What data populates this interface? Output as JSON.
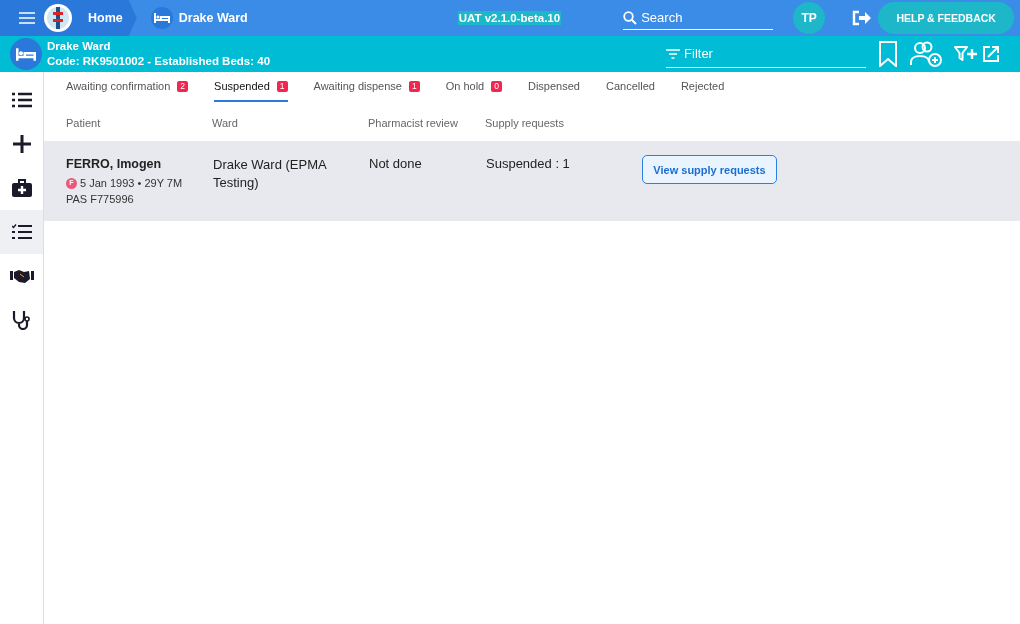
{
  "top_bar": {
    "breadcrumbs": [
      {
        "label": "Home",
        "kind": "home"
      },
      {
        "label": "Drake Ward",
        "kind": "ward"
      }
    ],
    "environment": "UAT v2.1.0-beta.10",
    "search": {
      "placeholder": "Search"
    },
    "user_initials": "TP",
    "help_button": "HELP & FEEDBACK"
  },
  "ward_bar": {
    "name": "Drake Ward",
    "details": "Code: RK9501002 - Established Beds: 40",
    "filter": {
      "placeholder": "Filter"
    }
  },
  "sidebar": {
    "items": [
      {
        "kind": "list",
        "selected": false
      },
      {
        "kind": "plus",
        "selected": false
      },
      {
        "kind": "medical-bag",
        "selected": false
      },
      {
        "kind": "checklist",
        "selected": true
      },
      {
        "kind": "handshake",
        "selected": false
      },
      {
        "kind": "stethoscope",
        "selected": false
      }
    ]
  },
  "tabs": [
    {
      "label": "Awaiting confirmation",
      "count": "2",
      "selected": false
    },
    {
      "label": "Suspended",
      "count": "1",
      "selected": true
    },
    {
      "label": "Awaiting dispense",
      "count": "1",
      "selected": false
    },
    {
      "label": "On hold",
      "count": "0",
      "selected": false
    },
    {
      "label": "Dispensed",
      "selected": false
    },
    {
      "label": "Cancelled",
      "selected": false
    },
    {
      "label": "Rejected",
      "selected": false
    }
  ],
  "table": {
    "columns": [
      "Patient",
      "Ward",
      "Pharmacist review",
      "Supply requests"
    ],
    "rows": [
      {
        "name": "FERRO, Imogen",
        "sex": "F",
        "dob": "5 Jan 1993 • 29Y 7M",
        "pas": "PAS F775996",
        "ward": "Drake Ward (EPMA Testing)",
        "pharmacist_review": "Not done",
        "supply_requests": "Suspended : 1",
        "action": "View supply requests"
      }
    ]
  }
}
